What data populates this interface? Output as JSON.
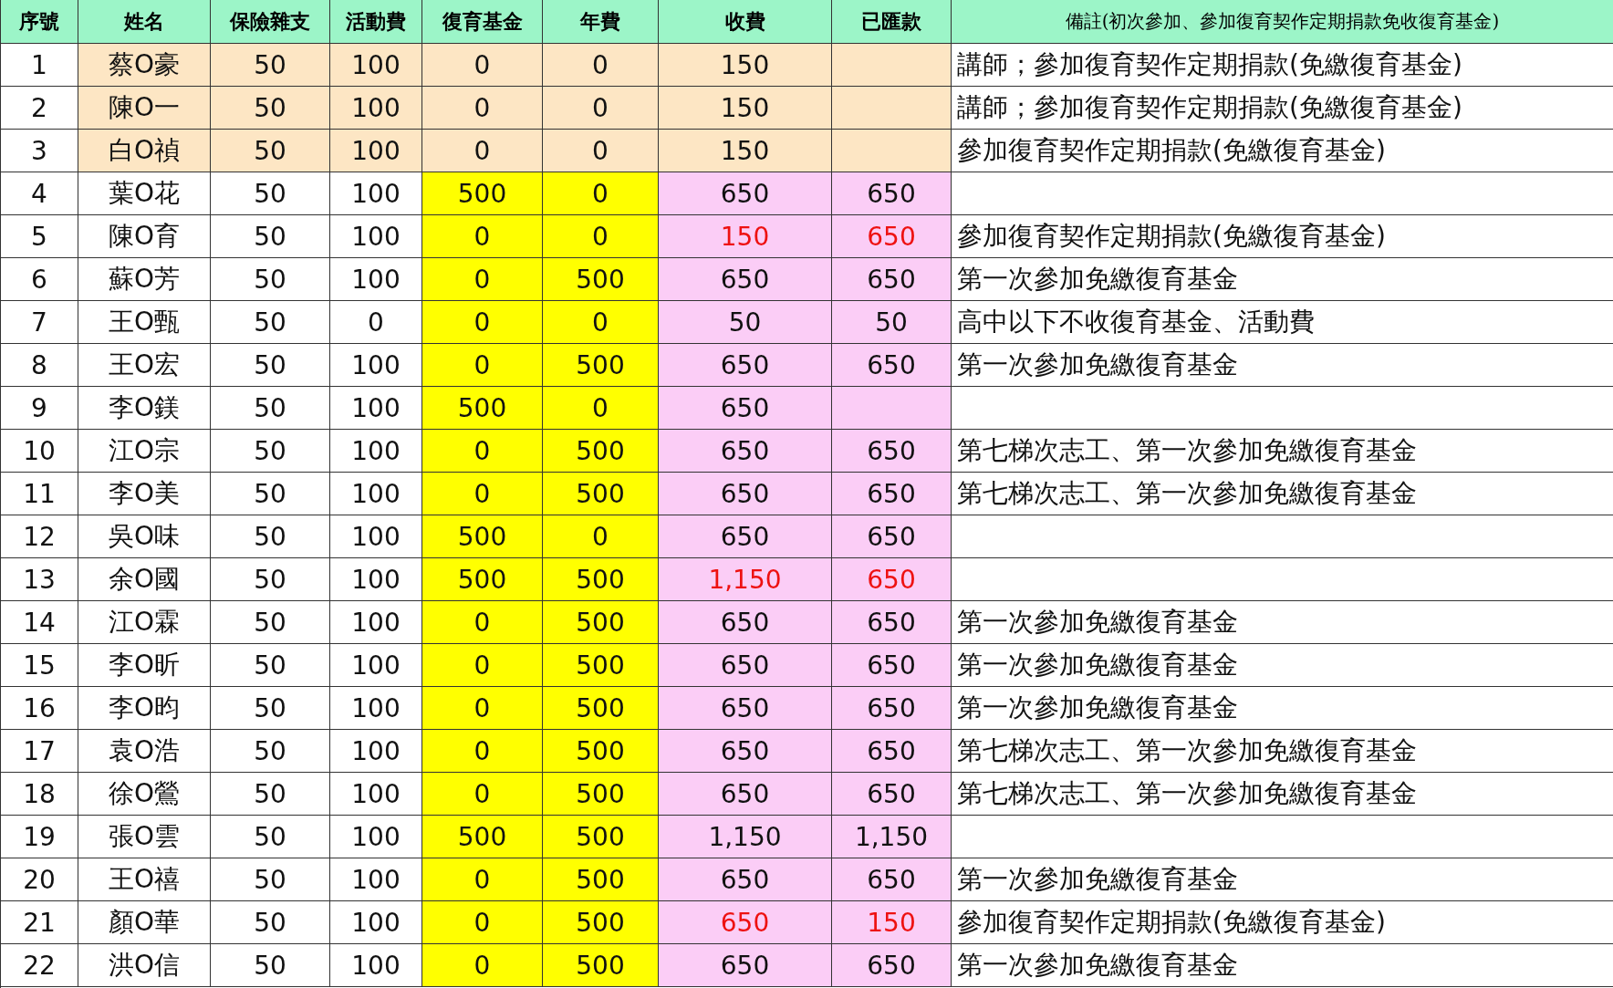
{
  "table": {
    "columns": [
      "序號",
      "姓名",
      "保險雜支",
      "活動費",
      "復育基金",
      "年費",
      "收費",
      "已匯款",
      "備註(初次參加、參加復育契作定期捐款免收復育基金)"
    ],
    "rows": [
      {
        "no": "1",
        "name": "蔡O豪",
        "insurance": "50",
        "activity": "100",
        "fund": "0",
        "annual": "0",
        "fee": "150",
        "note": "講師；參加復育契作定期捐款(免繳復育基金)",
        "kind": "instructor",
        "mismatch": false
      },
      {
        "no": "2",
        "name": "陳O一",
        "insurance": "50",
        "activity": "100",
        "fund": "0",
        "annual": "0",
        "fee": "150",
        "note": "講師；參加復育契作定期捐款(免繳復育基金)",
        "kind": "instructor",
        "mismatch": false
      },
      {
        "no": "3",
        "name": "白O禎",
        "insurance": "50",
        "activity": "100",
        "fund": "0",
        "annual": "0",
        "fee": "150",
        "note": "參加復育契作定期捐款(免繳復育基金)",
        "kind": "instructor",
        "mismatch": false
      },
      {
        "no": "4",
        "name": "葉O花",
        "insurance": "50",
        "activity": "100",
        "fund": "500",
        "annual": "0",
        "fee": "650",
        "paid": "650",
        "kind": "member",
        "mismatch": false
      },
      {
        "no": "5",
        "name": "陳O育",
        "insurance": "50",
        "activity": "100",
        "fund": "0",
        "annual": "0",
        "fee": "150",
        "paid": "650",
        "note": "參加復育契作定期捐款(免繳復育基金)",
        "kind": "member",
        "mismatch": true
      },
      {
        "no": "6",
        "name": "蘇O芳",
        "insurance": "50",
        "activity": "100",
        "fund": "0",
        "annual": "500",
        "fee": "650",
        "paid": "650",
        "note": "第一次參加免繳復育基金",
        "kind": "member",
        "mismatch": false
      },
      {
        "no": "7",
        "name": "王O甄",
        "insurance": "50",
        "activity": "0",
        "fund": "0",
        "annual": "0",
        "fee": "50",
        "paid": "50",
        "note": "高中以下不收復育基金、活動費",
        "kind": "member",
        "mismatch": false
      },
      {
        "no": "8",
        "name": "王O宏",
        "insurance": "50",
        "activity": "100",
        "fund": "0",
        "annual": "500",
        "fee": "650",
        "paid": "650",
        "note": "第一次參加免繳復育基金",
        "kind": "member",
        "mismatch": false
      },
      {
        "no": "9",
        "name": "李O鎂",
        "insurance": "50",
        "activity": "100",
        "fund": "500",
        "annual": "0",
        "fee": "650",
        "kind": "member",
        "mismatch": false
      },
      {
        "no": "10",
        "name": "江O宗",
        "insurance": "50",
        "activity": "100",
        "fund": "0",
        "annual": "500",
        "fee": "650",
        "paid": "650",
        "note": "第七梯次志工、第一次參加免繳復育基金",
        "kind": "member",
        "mismatch": false
      },
      {
        "no": "11",
        "name": "李O美",
        "insurance": "50",
        "activity": "100",
        "fund": "0",
        "annual": "500",
        "fee": "650",
        "paid": "650",
        "note": "第七梯次志工、第一次參加免繳復育基金",
        "kind": "member",
        "mismatch": false
      },
      {
        "no": "12",
        "name": "吳O味",
        "insurance": "50",
        "activity": "100",
        "fund": "500",
        "annual": "0",
        "fee": "650",
        "paid": "650",
        "kind": "member",
        "mismatch": false
      },
      {
        "no": "13",
        "name": "余O國",
        "insurance": "50",
        "activity": "100",
        "fund": "500",
        "annual": "500",
        "fee": "1,150",
        "paid": "650",
        "kind": "member",
        "mismatch": true
      },
      {
        "no": "14",
        "name": "江O霖",
        "insurance": "50",
        "activity": "100",
        "fund": "0",
        "annual": "500",
        "fee": "650",
        "paid": "650",
        "note": "第一次參加免繳復育基金",
        "kind": "member",
        "mismatch": false
      },
      {
        "no": "15",
        "name": "李O昕",
        "insurance": "50",
        "activity": "100",
        "fund": "0",
        "annual": "500",
        "fee": "650",
        "paid": "650",
        "note": "第一次參加免繳復育基金",
        "kind": "member",
        "mismatch": false
      },
      {
        "no": "16",
        "name": "李O昀",
        "insurance": "50",
        "activity": "100",
        "fund": "0",
        "annual": "500",
        "fee": "650",
        "paid": "650",
        "note": "第一次參加免繳復育基金",
        "kind": "member",
        "mismatch": false
      },
      {
        "no": "17",
        "name": "袁O浩",
        "insurance": "50",
        "activity": "100",
        "fund": "0",
        "annual": "500",
        "fee": "650",
        "paid": "650",
        "note": "第七梯次志工、第一次參加免繳復育基金",
        "kind": "member",
        "mismatch": false
      },
      {
        "no": "18",
        "name": "徐O鶯",
        "insurance": "50",
        "activity": "100",
        "fund": "0",
        "annual": "500",
        "fee": "650",
        "paid": "650",
        "note": "第七梯次志工、第一次參加免繳復育基金",
        "kind": "member",
        "mismatch": false
      },
      {
        "no": "19",
        "name": "張O雲",
        "insurance": "50",
        "activity": "100",
        "fund": "500",
        "annual": "500",
        "fee": "1,150",
        "paid": "1,150",
        "kind": "member",
        "mismatch": false
      },
      {
        "no": "20",
        "name": "王O禧",
        "insurance": "50",
        "activity": "100",
        "fund": "0",
        "annual": "500",
        "fee": "650",
        "paid": "650",
        "note": "第一次參加免繳復育基金",
        "kind": "member",
        "mismatch": false
      },
      {
        "no": "21",
        "name": "顏O華",
        "insurance": "50",
        "activity": "100",
        "fund": "0",
        "annual": "500",
        "fee": "650",
        "paid": "150",
        "note": "參加復育契作定期捐款(免繳復育基金)",
        "kind": "member",
        "mismatch": true
      },
      {
        "no": "22",
        "name": "洪O信",
        "insurance": "50",
        "activity": "100",
        "fund": "0",
        "annual": "500",
        "fee": "650",
        "paid": "650",
        "note": "第一次參加免繳復育基金",
        "kind": "member",
        "mismatch": false
      }
    ]
  }
}
